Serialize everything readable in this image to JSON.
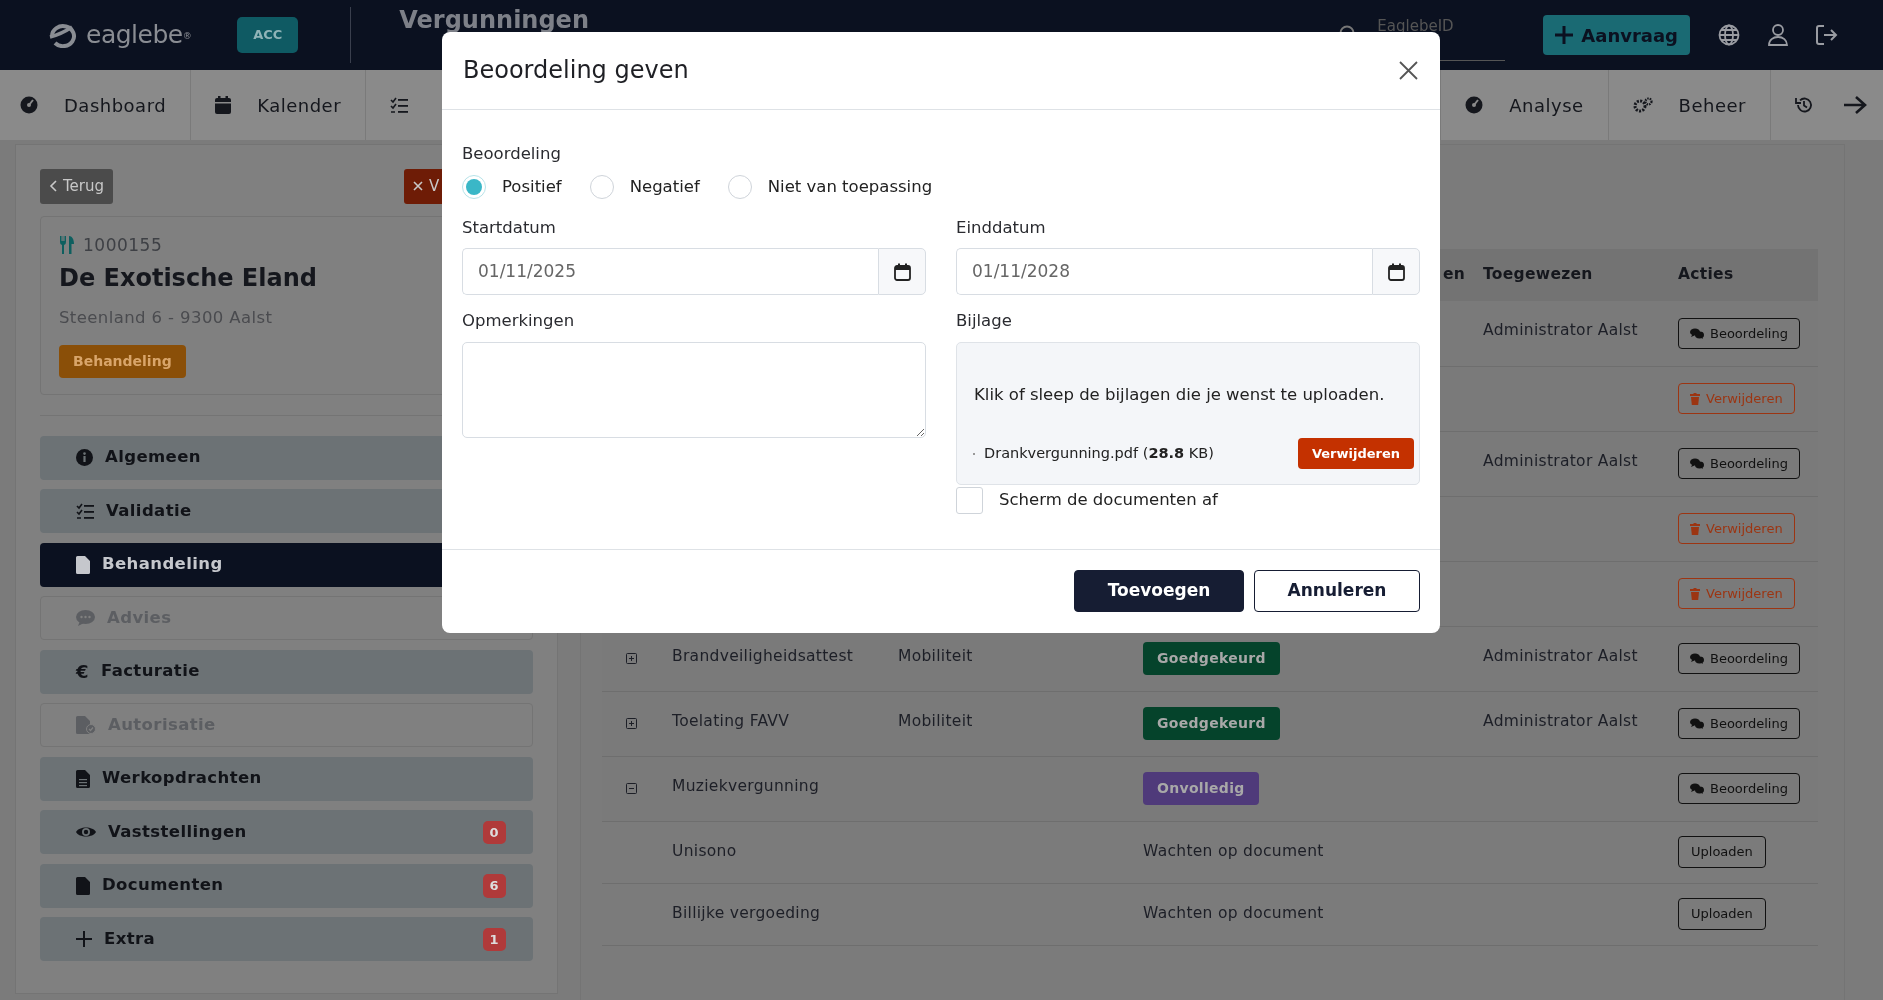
{
  "topbar": {
    "logo": "eaglebe$^{®}$",
    "environment": "ACC",
    "title": "Vergunningen",
    "search": {
      "placeholder": "EaglebeID"
    },
    "new_button": "Aanvraag"
  },
  "mainnav": {
    "left": [
      {
        "label": "Dashboard"
      },
      {
        "label": "Kalender"
      }
    ],
    "right": [
      {
        "label": "Analyse"
      },
      {
        "label": "Beheer"
      }
    ]
  },
  "sidebar": {
    "back_button": "Terug",
    "close_button": "V",
    "card": {
      "number": "1000155",
      "name": "De Exotische Eland",
      "address": "Steenland 6 - 9300 Aalst",
      "status": "Behandeling"
    },
    "items": [
      {
        "label": "Algemeen",
        "selected": false,
        "disabled": false
      },
      {
        "label": "Validatie",
        "selected": false,
        "disabled": false
      },
      {
        "label": "Behandeling",
        "selected": true,
        "disabled": false
      },
      {
        "label": "Advies",
        "selected": false,
        "disabled": true
      },
      {
        "label": "Facturatie",
        "symbol": "€",
        "selected": false,
        "disabled": false
      },
      {
        "label": "Autorisatie",
        "selected": false,
        "disabled": true
      },
      {
        "label": "Werkopdrachten",
        "selected": false,
        "disabled": false
      },
      {
        "label": "Vaststellingen",
        "count": "0",
        "selected": false,
        "disabled": false
      },
      {
        "label": "Documenten",
        "count": "6",
        "selected": false,
        "disabled": false
      },
      {
        "label": "Extra",
        "count": "1",
        "selected": false,
        "disabled": false
      }
    ]
  },
  "table": {
    "columns": {
      "column_4": "en",
      "assigned": "Toegewezen",
      "actions": "Acties"
    },
    "rows": [
      {
        "assigned": "Administrator Aalst",
        "action": {
          "kind": "review",
          "label": "Beoordeling"
        }
      },
      {
        "action": {
          "kind": "delete",
          "label": "Verwijderen"
        }
      },
      {
        "assigned": "Administrator Aalst",
        "action": {
          "kind": "review",
          "label": "Beoordeling"
        }
      },
      {
        "action": {
          "kind": "delete",
          "label": "Verwijderen"
        }
      },
      {
        "action": {
          "kind": "delete",
          "label": "Verwijderen"
        }
      },
      {
        "expanded": false,
        "name": "Brandveiligheidsattest",
        "category": "Mobiliteit",
        "status": {
          "kind": "badge",
          "label": "Goedgekeurd",
          "color": "#05432b"
        },
        "assigned": "Administrator Aalst",
        "action": {
          "kind": "review",
          "label": "Beoordeling"
        }
      },
      {
        "expanded": false,
        "name": "Toelating FAVV",
        "category": "Mobiliteit",
        "status": {
          "kind": "badge",
          "label": "Goedgekeurd",
          "color": "#05432b"
        },
        "assigned": "Administrator Aalst",
        "action": {
          "kind": "review",
          "label": "Beoordeling"
        }
      },
      {
        "expanded": true,
        "name": "Muziekvergunning",
        "status": {
          "kind": "badge",
          "label": "Onvolledig",
          "color": "#4f3a7a"
        },
        "action": {
          "kind": "review",
          "label": "Beoordeling"
        },
        "children": [
          {
            "name": "Unisono",
            "status": {
              "kind": "text",
              "label": "Wachten op document"
            },
            "action": {
              "kind": "upload",
              "label": "Uploaden"
            }
          },
          {
            "name": "Billijke vergoeding",
            "status": {
              "kind": "text",
              "label": "Wachten op document"
            },
            "action": {
              "kind": "upload",
              "label": "Uploaden"
            }
          }
        ]
      }
    ]
  },
  "modal": {
    "title": "Beoordeling geven",
    "rating": {
      "label": "Beoordeling",
      "options": [
        {
          "label": "Positief",
          "selected": true
        },
        {
          "label": "Negatief",
          "selected": false
        },
        {
          "label": "Niet van toepassing",
          "selected": false
        }
      ]
    },
    "start_date": {
      "label": "Startdatum",
      "value": "01/11/2025"
    },
    "end_date": {
      "label": "Einddatum",
      "value": "01/11/2028"
    },
    "remarks": {
      "label": "Opmerkingen"
    },
    "attachment": {
      "label": "Bijlage",
      "hint": "Klik of sleep de bijlagen die je wenst te uploaden.",
      "files": [
        {
          "name": "Drankvergunning.pdf (**28.8** KB)",
          "remove_button": "Verwijderen"
        }
      ]
    },
    "shield": {
      "label": "Scherm de documenten af",
      "checked": false
    },
    "buttons": [
      {
        "label": "Toevoegen",
        "kind": "primary"
      },
      {
        "label": "Annuleren",
        "kind": "outline"
      }
    ]
  }
}
